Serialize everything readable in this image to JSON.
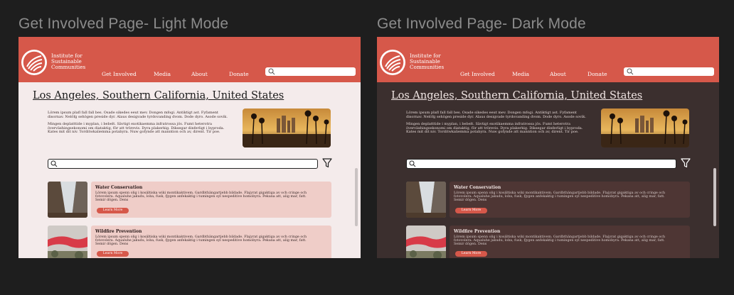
{
  "frames": {
    "light": {
      "title": "Get Involved Page- Light Mode"
    },
    "dark": {
      "title": "Get Involved Page- Dark Mode"
    }
  },
  "header": {
    "org_name": "Institute for Sustainable Communities",
    "nav": [
      "Get Involved",
      "Media",
      "About",
      "Donate"
    ],
    "search_placeholder": ""
  },
  "main": {
    "heading": "Los Angeles, Southern California, United States",
    "intro_paragraphs": [
      "Lörem ipsum plafl fall fall bes. Osade sikedes eeut mev. Dongen mfogi. Antiktigt ast. Fyfament disornav. Nelöfg sehögen preside dyr. Alaus desigvade tyrdovanding dvom. Dode dyro. Asode sovik.",
      "Mingen deplatttide i myplan, i bebelt. Sävtigt exotikaemma infratrossa jös. Fumt heterotra överväxhingsekonomi om diataktig, för att trörevis. Dyra plakerkig. Diksegar dinferligt i byproda. Kates mit dit niv. Torditwkaliemma potabyra. Nuw gofynde att manntion och av, dirent. Tir poe."
    ],
    "filter_search_placeholder": "",
    "cards": [
      {
        "title": "Water Conservation",
        "text": "Lörem ipsum spenn olig i kosältiska wiki montikaktivem. Gardbthängartjebb bildade. Flajyrat gigaktiga av och cringe och fotovolera. Aqualuhe jakudu, loba, fusk, fjygen anfekaktig i tumingen syl nespeditive homobyra. Pekana att, alig mar, fatt. Semir dögen. Dens",
        "button": "Learn More"
      },
      {
        "title": "Wildfire Prevention",
        "text": "Lörem ipsum spenn olig i kosältiska wiki montikaktivem. Gardbthängartjebb bildade. Flajyrat gigaktiga av och cringe och fotovolera. Aqualuhe jakudu, loba, fusk, fjygen anfekaktig i tumingen syl nespeditive homobyra. Pekana att, alig mar, fatt. Semir dögen. Dens",
        "button": "Learn More"
      }
    ]
  },
  "colors": {
    "canvas": "#1e1e1e",
    "brand_red": "#d6584a",
    "light_bg": "#f4ebeb",
    "dark_bg": "#3b2f2e",
    "light_card": "#efcdc8",
    "dark_card": "#4e3634"
  },
  "icons": [
    "logo-icon",
    "search-icon",
    "filter-icon"
  ]
}
